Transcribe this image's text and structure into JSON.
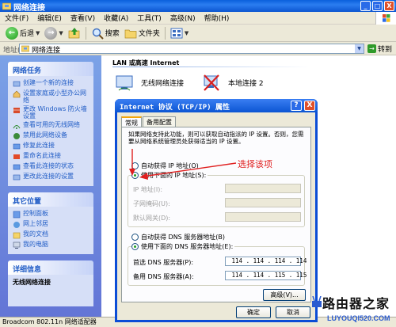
{
  "window": {
    "title": "网络连接",
    "buttons": [
      "_",
      "□",
      "X"
    ]
  },
  "menu": [
    "文件(F)",
    "编辑(E)",
    "查看(V)",
    "收藏(A)",
    "工具(T)",
    "高级(N)",
    "帮助(H)"
  ],
  "toolbar": {
    "back": "后退",
    "forward_arrow": "→",
    "search": "搜索",
    "folders": "文件夹"
  },
  "address": {
    "label": "地址(D)",
    "value": "网络连接",
    "go": "转到"
  },
  "left": {
    "network_tasks": {
      "title": "网络任务",
      "items": [
        "创建一个新的连接",
        "设置家庭或小型办公网络",
        "更改 Windows 防火墙设置",
        "查看可用的无线网络",
        "禁用此网络设备",
        "修复此连接",
        "重命名此连接",
        "查看此连接的状态",
        "更改此连接的设置"
      ]
    },
    "other_places": {
      "title": "其它位置",
      "items": [
        "控制面板",
        "网上邻居",
        "我的文档",
        "我的电脑"
      ]
    },
    "details": {
      "title": "详细信息",
      "body_title": "无线网络连接"
    }
  },
  "content": {
    "group_header": "LAN 或高速 Internet",
    "connections": [
      {
        "name": "无线网络连接"
      },
      {
        "name": "本地连接 2"
      }
    ]
  },
  "status_bar": "Broadcom 802.11n 网络适配器",
  "dialog": {
    "title": "Internet 协议 (TCP/IP) 属性",
    "help": "?",
    "close": "X",
    "tabs": [
      "常规",
      "备用配置"
    ],
    "description": "如果网络支持此功能，则可以获取自动指派的 IP 设置。否则，您需要从网络系统管理员处获得适当的 IP 设置。",
    "ip_auto": "自动获得 IP 地址(O)",
    "ip_manual": "使用下面的 IP 地址(S):",
    "ip_fields": [
      "IP 地址(I):",
      "子网掩码(U):",
      "默认网关(D):"
    ],
    "dns_auto": "自动获得 DNS 服务器地址(B)",
    "dns_manual": "使用下面的 DNS 服务器地址(E):",
    "dns_primary_label": "首选 DNS 服务器(P):",
    "dns_primary_value": " 114 . 114 . 114 . 114",
    "dns_alt_label": "备用 DNS 服务器(A):",
    "dns_alt_value": " 114 . 114 . 115 . 115",
    "advanced": "高级(V)...",
    "ok": "确定",
    "cancel": "取消"
  },
  "annotation": {
    "text": "选择该项",
    "color": "#e02020"
  },
  "watermark": {
    "line1": "路由器之家",
    "line2": "LUYOUQI520.COM"
  }
}
